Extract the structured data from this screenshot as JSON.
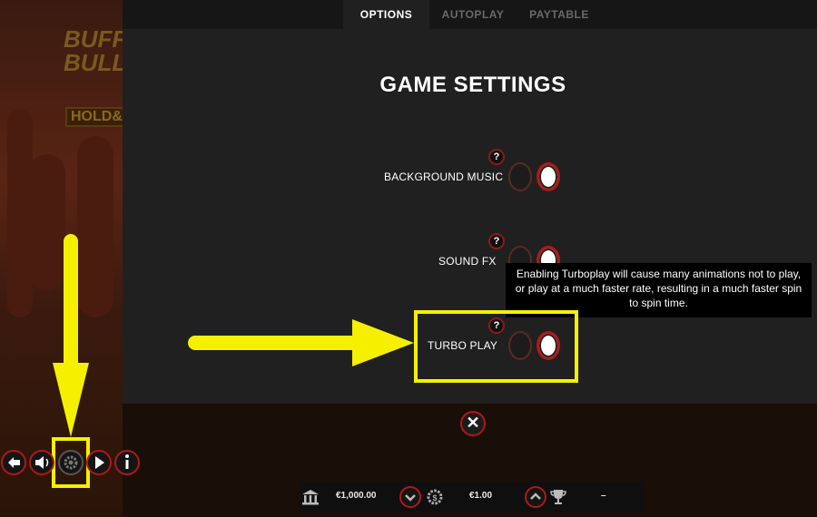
{
  "tabs": [
    {
      "label": "OPTIONS",
      "active": true
    },
    {
      "label": "AUTOPLAY",
      "active": false
    },
    {
      "label": "PAYTABLE",
      "active": false
    }
  ],
  "panel": {
    "title": "GAME SETTINGS",
    "settings": [
      {
        "label": "BACKGROUND MUSIC",
        "help": "?",
        "enabled": true
      },
      {
        "label": "SOUND FX",
        "help": "?",
        "enabled": true
      },
      {
        "label": "TURBO PLAY",
        "help": "?",
        "enabled": true
      }
    ],
    "tooltip": "Enabling Turboplay will cause many animations not to play, or play at a much faster rate, resulting in a much faster spin to spin time.",
    "close_symbol": "✕"
  },
  "game_logo": {
    "line1": "BUFF",
    "line2": "BULL",
    "line3": "HOLD&"
  },
  "bottom_bar": {
    "balance": "€1,000.00",
    "bet": "€1.00",
    "win": "–"
  },
  "side_controls": [
    {
      "icon": "back-arrow-icon"
    },
    {
      "icon": "speaker-icon"
    },
    {
      "icon": "gear-icon"
    },
    {
      "icon": "play-icon"
    },
    {
      "icon": "info-icon"
    }
  ],
  "colors": {
    "panel_bg": "#202020",
    "accent_red": "#b01818",
    "annotation_yellow": "#f5f000",
    "tab_inactive": "#6a6a6a"
  }
}
